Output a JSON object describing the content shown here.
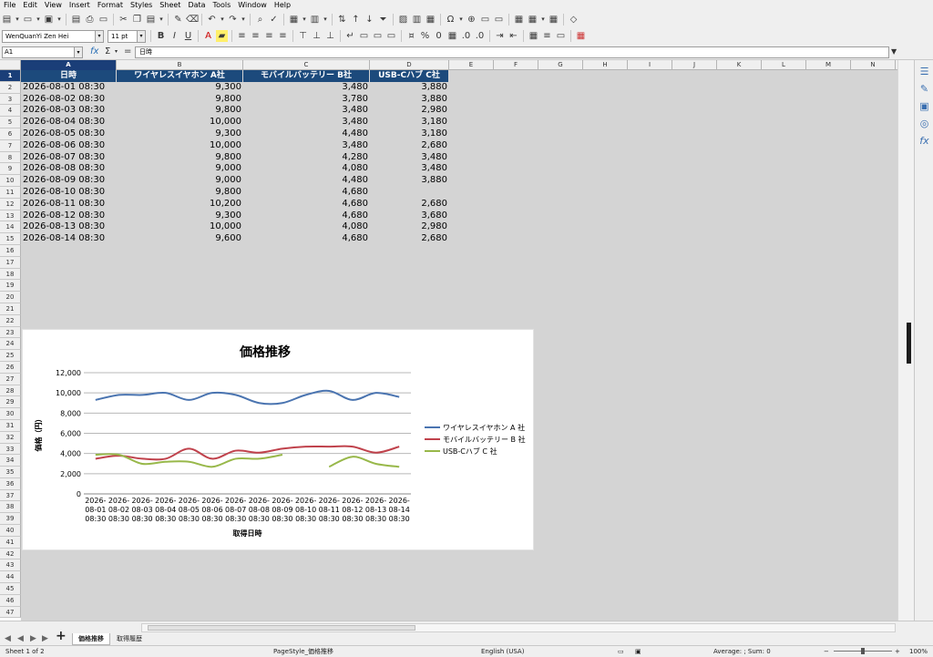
{
  "menu": [
    "File",
    "Edit",
    "View",
    "Insert",
    "Format",
    "Styles",
    "Sheet",
    "Data",
    "Tools",
    "Window",
    "Help"
  ],
  "toolbar": {
    "font_name": "WenQuanYi Zen Hei",
    "font_size": "11 pt"
  },
  "formula_bar": {
    "cell_ref": "A1",
    "content": "日時"
  },
  "columns": [
    "A",
    "B",
    "C",
    "D",
    "E",
    "F",
    "G",
    "H",
    "I",
    "J",
    "K",
    "L",
    "M",
    "N"
  ],
  "selected_column": "A",
  "selected_row": "1",
  "table": {
    "headers": [
      "日時",
      "ワイヤレスイヤホン A社",
      "モバイルバッテリー B社",
      "USB-Cハブ C社"
    ],
    "rows": [
      [
        "2026-08-01 08:30",
        "9,300",
        "3,480",
        "3,880"
      ],
      [
        "2026-08-02 08:30",
        "9,800",
        "3,780",
        "3,880"
      ],
      [
        "2026-08-03 08:30",
        "9,800",
        "3,480",
        "2,980"
      ],
      [
        "2026-08-04 08:30",
        "10,000",
        "3,480",
        "3,180"
      ],
      [
        "2026-08-05 08:30",
        "9,300",
        "4,480",
        "3,180"
      ],
      [
        "2026-08-06 08:30",
        "10,000",
        "3,480",
        "2,680"
      ],
      [
        "2026-08-07 08:30",
        "9,800",
        "4,280",
        "3,480"
      ],
      [
        "2026-08-08 08:30",
        "9,000",
        "4,080",
        "3,480"
      ],
      [
        "2026-08-09 08:30",
        "9,000",
        "4,480",
        "3,880"
      ],
      [
        "2026-08-10 08:30",
        "9,800",
        "4,680",
        ""
      ],
      [
        "2026-08-11 08:30",
        "10,200",
        "4,680",
        "2,680"
      ],
      [
        "2026-08-12 08:30",
        "9,300",
        "4,680",
        "3,680"
      ],
      [
        "2026-08-13 08:30",
        "10,000",
        "4,080",
        "2,980"
      ],
      [
        "2026-08-14 08:30",
        "9,600",
        "4,680",
        "2,680"
      ]
    ]
  },
  "row_numbers": [
    "1",
    "2",
    "3",
    "4",
    "5",
    "6",
    "7",
    "8",
    "9",
    "10",
    "11",
    "12",
    "13",
    "14",
    "15",
    "16",
    "17",
    "18",
    "19",
    "20",
    "21",
    "22",
    "23",
    "24",
    "25",
    "26",
    "27",
    "28",
    "29",
    "30",
    "31",
    "32",
    "33",
    "34",
    "35",
    "36",
    "37",
    "38",
    "39",
    "40",
    "41",
    "42",
    "43",
    "44",
    "45",
    "46",
    "47"
  ],
  "chart_data": {
    "type": "line",
    "title": "価格推移",
    "xlabel": "取得日時",
    "ylabel": "価格（円）",
    "ylim": [
      0,
      12000
    ],
    "yticks": [
      "0",
      "2,000",
      "4,000",
      "6,000",
      "8,000",
      "10,000",
      "12,000"
    ],
    "categories": [
      "2026-08-01 08:30",
      "2026-08-02 08:30",
      "2026-08-03 08:30",
      "2026-08-04 08:30",
      "2026-08-05 08:30",
      "2026-08-06 08:30",
      "2026-08-07 08:30",
      "2026-08-08 08:30",
      "2026-08-09 08:30",
      "2026-08-10 08:30",
      "2026-08-11 08:30",
      "2026-08-12 08:30",
      "2026-08-13 08:30",
      "2026-08-14 08:30"
    ],
    "legend_position": "right",
    "grid": true,
    "series": [
      {
        "name": "ワイヤレスイヤホン A 社",
        "color": "#4a74b0",
        "values": [
          9300,
          9800,
          9800,
          10000,
          9300,
          10000,
          9800,
          9000,
          9000,
          9800,
          10200,
          9300,
          10000,
          9600
        ]
      },
      {
        "name": "モバイルバッテリー B 社",
        "color": "#c0424c",
        "values": [
          3480,
          3780,
          3480,
          3480,
          4480,
          3480,
          4280,
          4080,
          4480,
          4680,
          4680,
          4680,
          4080,
          4680
        ]
      },
      {
        "name": "USB-Cハブ C 社",
        "color": "#98b84a",
        "values": [
          3880,
          3880,
          2980,
          3180,
          3180,
          2680,
          3480,
          3480,
          3880,
          null,
          2680,
          3680,
          2980,
          2680
        ]
      }
    ]
  },
  "sheets": [
    "価格推移",
    "取得履歴"
  ],
  "active_sheet": "価格推移",
  "status": {
    "sheet": "Sheet 1 of 2",
    "page_style": "PageStyle_価格推移",
    "language": "English (USA)",
    "summary": "Average: ; Sum: 0",
    "zoom": "100%"
  }
}
